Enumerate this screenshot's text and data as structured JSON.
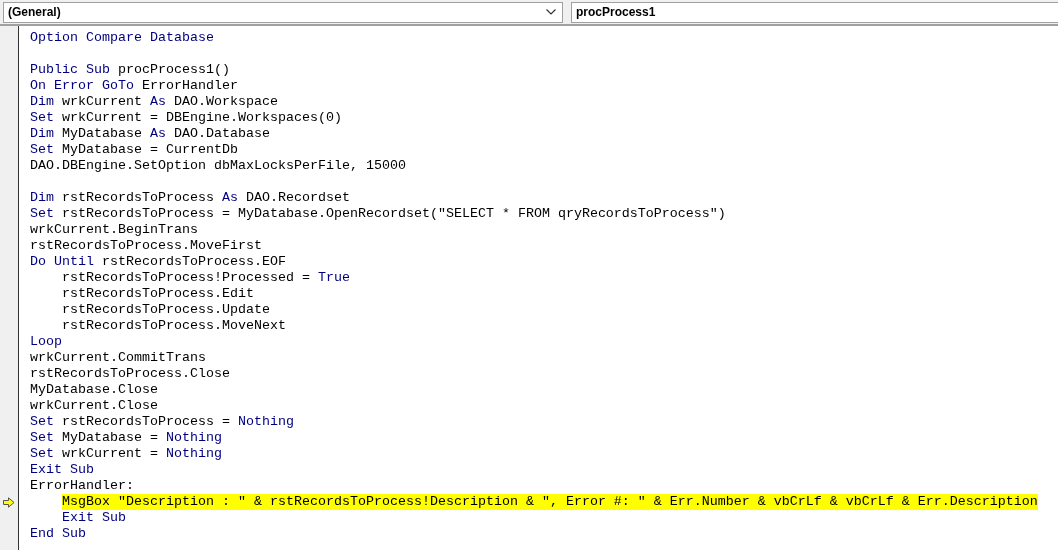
{
  "object_box": {
    "value": "(General)"
  },
  "procedure_box": {
    "value": "procProcess1"
  },
  "code_lines": [
    {
      "kind": "code",
      "highlighted": false,
      "current": false,
      "segments": [
        {
          "kind": "keyword",
          "text": "Option Compare Database"
        }
      ]
    },
    {
      "kind": "blank"
    },
    {
      "kind": "code",
      "highlighted": false,
      "current": false,
      "segments": [
        {
          "kind": "keyword",
          "text": "Public Sub"
        },
        {
          "kind": "plain",
          "text": " procProcess1()"
        }
      ]
    },
    {
      "kind": "code",
      "highlighted": false,
      "current": false,
      "segments": [
        {
          "kind": "keyword",
          "text": "On Error GoTo"
        },
        {
          "kind": "plain",
          "text": " ErrorHandler"
        }
      ]
    },
    {
      "kind": "code",
      "highlighted": false,
      "current": false,
      "segments": [
        {
          "kind": "keyword",
          "text": "Dim"
        },
        {
          "kind": "plain",
          "text": " wrkCurrent "
        },
        {
          "kind": "keyword",
          "text": "As"
        },
        {
          "kind": "plain",
          "text": " DAO.Workspace"
        }
      ]
    },
    {
      "kind": "code",
      "highlighted": false,
      "current": false,
      "segments": [
        {
          "kind": "keyword",
          "text": "Set"
        },
        {
          "kind": "plain",
          "text": " wrkCurrent = DBEngine.Workspaces(0)"
        }
      ]
    },
    {
      "kind": "code",
      "highlighted": false,
      "current": false,
      "segments": [
        {
          "kind": "keyword",
          "text": "Dim"
        },
        {
          "kind": "plain",
          "text": " MyDatabase "
        },
        {
          "kind": "keyword",
          "text": "As"
        },
        {
          "kind": "plain",
          "text": " DAO.Database"
        }
      ]
    },
    {
      "kind": "code",
      "highlighted": false,
      "current": false,
      "segments": [
        {
          "kind": "keyword",
          "text": "Set"
        },
        {
          "kind": "plain",
          "text": " MyDatabase = CurrentDb"
        }
      ]
    },
    {
      "kind": "code",
      "highlighted": false,
      "current": false,
      "segments": [
        {
          "kind": "plain",
          "text": "DAO.DBEngine.SetOption dbMaxLocksPerFile, 15000"
        }
      ]
    },
    {
      "kind": "blank"
    },
    {
      "kind": "code",
      "highlighted": false,
      "current": false,
      "segments": [
        {
          "kind": "keyword",
          "text": "Dim"
        },
        {
          "kind": "plain",
          "text": " rstRecordsToProcess "
        },
        {
          "kind": "keyword",
          "text": "As"
        },
        {
          "kind": "plain",
          "text": " DAO.Recordset"
        }
      ]
    },
    {
      "kind": "code",
      "highlighted": false,
      "current": false,
      "segments": [
        {
          "kind": "keyword",
          "text": "Set"
        },
        {
          "kind": "plain",
          "text": " rstRecordsToProcess = MyDatabase.OpenRecordset(\"SELECT * FROM qryRecordsToProcess\")"
        }
      ]
    },
    {
      "kind": "code",
      "highlighted": false,
      "current": false,
      "segments": [
        {
          "kind": "plain",
          "text": "wrkCurrent.BeginTrans"
        }
      ]
    },
    {
      "kind": "code",
      "highlighted": false,
      "current": false,
      "segments": [
        {
          "kind": "plain",
          "text": "rstRecordsToProcess.MoveFirst"
        }
      ]
    },
    {
      "kind": "code",
      "highlighted": false,
      "current": false,
      "segments": [
        {
          "kind": "keyword",
          "text": "Do Until"
        },
        {
          "kind": "plain",
          "text": " rstRecordsToProcess.EOF"
        }
      ]
    },
    {
      "kind": "code",
      "highlighted": false,
      "current": false,
      "segments": [
        {
          "kind": "plain",
          "text": "    rstRecordsToProcess!Processed = "
        },
        {
          "kind": "keyword",
          "text": "True"
        }
      ]
    },
    {
      "kind": "code",
      "highlighted": false,
      "current": false,
      "segments": [
        {
          "kind": "plain",
          "text": "    rstRecordsToProcess.Edit"
        }
      ]
    },
    {
      "kind": "code",
      "highlighted": false,
      "current": false,
      "segments": [
        {
          "kind": "plain",
          "text": "    rstRecordsToProcess.Update"
        }
      ]
    },
    {
      "kind": "code",
      "highlighted": false,
      "current": false,
      "segments": [
        {
          "kind": "plain",
          "text": "    rstRecordsToProcess.MoveNext"
        }
      ]
    },
    {
      "kind": "code",
      "highlighted": false,
      "current": false,
      "segments": [
        {
          "kind": "keyword",
          "text": "Loop"
        }
      ]
    },
    {
      "kind": "code",
      "highlighted": false,
      "current": false,
      "segments": [
        {
          "kind": "plain",
          "text": "wrkCurrent.CommitTrans"
        }
      ]
    },
    {
      "kind": "code",
      "highlighted": false,
      "current": false,
      "segments": [
        {
          "kind": "plain",
          "text": "rstRecordsToProcess.Close"
        }
      ]
    },
    {
      "kind": "code",
      "highlighted": false,
      "current": false,
      "segments": [
        {
          "kind": "plain",
          "text": "MyDatabase.Close"
        }
      ]
    },
    {
      "kind": "code",
      "highlighted": false,
      "current": false,
      "segments": [
        {
          "kind": "plain",
          "text": "wrkCurrent.Close"
        }
      ]
    },
    {
      "kind": "code",
      "highlighted": false,
      "current": false,
      "segments": [
        {
          "kind": "keyword",
          "text": "Set"
        },
        {
          "kind": "plain",
          "text": " rstRecordsToProcess = "
        },
        {
          "kind": "keyword",
          "text": "Nothing"
        }
      ]
    },
    {
      "kind": "code",
      "highlighted": false,
      "current": false,
      "segments": [
        {
          "kind": "keyword",
          "text": "Set"
        },
        {
          "kind": "plain",
          "text": " MyDatabase = "
        },
        {
          "kind": "keyword",
          "text": "Nothing"
        }
      ]
    },
    {
      "kind": "code",
      "highlighted": false,
      "current": false,
      "segments": [
        {
          "kind": "keyword",
          "text": "Set"
        },
        {
          "kind": "plain",
          "text": " wrkCurrent = "
        },
        {
          "kind": "keyword",
          "text": "Nothing"
        }
      ]
    },
    {
      "kind": "code",
      "highlighted": false,
      "current": false,
      "segments": [
        {
          "kind": "keyword",
          "text": "Exit Sub"
        }
      ]
    },
    {
      "kind": "code",
      "highlighted": false,
      "current": false,
      "segments": [
        {
          "kind": "plain",
          "text": "ErrorHandler:"
        }
      ]
    },
    {
      "kind": "code",
      "highlighted": true,
      "current": true,
      "segments": [
        {
          "kind": "plain",
          "text": "    MsgBox \"Description : \" & rstRecordsToProcess!Description & \", Error #: \" & Err.Number & vbCrLf & vbCrLf & Err.Description"
        }
      ]
    },
    {
      "kind": "code",
      "highlighted": false,
      "current": false,
      "segments": [
        {
          "kind": "keyword",
          "text": "    Exit Sub"
        }
      ]
    },
    {
      "kind": "code",
      "highlighted": false,
      "current": false,
      "segments": [
        {
          "kind": "keyword",
          "text": "End Sub"
        }
      ]
    }
  ]
}
